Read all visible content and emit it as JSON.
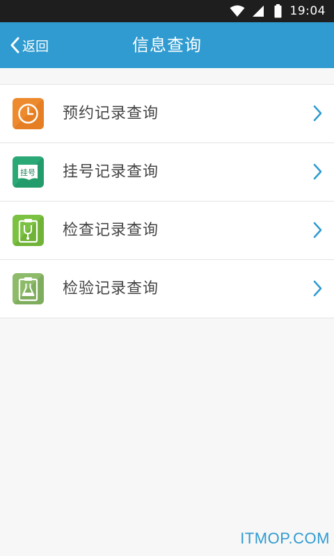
{
  "status_bar": {
    "time": "19:04",
    "icons": [
      "wifi-icon",
      "cell-signal-icon",
      "battery-icon"
    ]
  },
  "header": {
    "back_label": "返回",
    "title": "信息查询",
    "background": "#2f9bd0"
  },
  "menu": {
    "items": [
      {
        "label": "预约记录查询",
        "icon": "clock-icon",
        "icon_color": "#ee8a2e"
      },
      {
        "label": "挂号记录查询",
        "icon": "registration-ticket-icon",
        "icon_color": "#2aa876",
        "icon_text": "挂号"
      },
      {
        "label": "检查记录查询",
        "icon": "stethoscope-clipboard-icon",
        "icon_color": "#7cc242"
      },
      {
        "label": "检验记录查询",
        "icon": "flask-clipboard-icon",
        "icon_color": "#8dbb6a"
      }
    ],
    "arrow_icon": "chevron-right-icon",
    "arrow_color": "#2f9bd0"
  },
  "watermark": "ITMOP.COM"
}
